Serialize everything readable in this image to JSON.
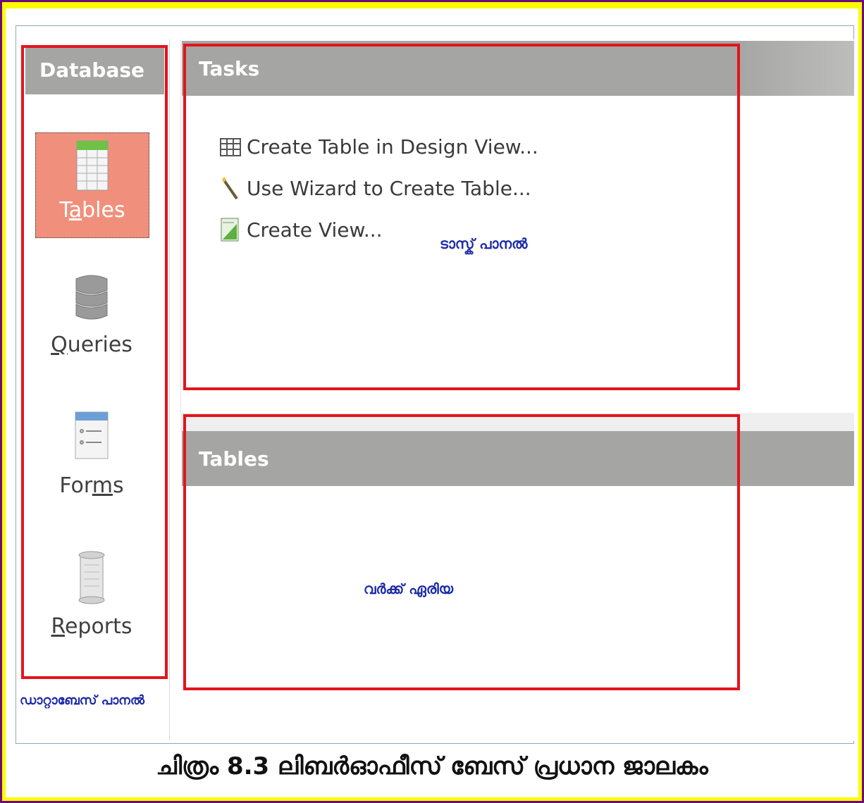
{
  "sidebar": {
    "header": "Database",
    "items": [
      {
        "label": "Tables",
        "underline_index": 1,
        "icon": "table-grid-icon",
        "selected": true
      },
      {
        "label": "Queries",
        "underline_index": 0,
        "icon": "database-cylinder-icon",
        "selected": false
      },
      {
        "label": "Forms",
        "underline_index": 3,
        "icon": "form-icon",
        "selected": false
      },
      {
        "label": "Reports",
        "underline_index": 0,
        "icon": "report-scroll-icon",
        "selected": false
      }
    ]
  },
  "tasks": {
    "header": "Tasks",
    "items": [
      {
        "label": "Create Table in Design View...",
        "icon": "table-design-icon"
      },
      {
        "label": "Use Wizard to Create Table...",
        "icon": "wand-icon"
      },
      {
        "label": "Create View...",
        "icon": "view-icon"
      }
    ]
  },
  "work": {
    "header": "Tables"
  },
  "annotations": {
    "task_panel": "ടാസ്ക് പാനൽ",
    "work_area": "വർക്ക് ഏരിയ",
    "database_panel": "ഡാറ്റാബേസ് പാനൽ"
  },
  "caption": "ചിത്രം 8.3 ലിബർഓഫീസ് ബേസ് പ്രധാന ജാലകം",
  "colors": {
    "frame_yellow": "#fcfc00",
    "frame_purple": "#6a0d7a",
    "header_gray": "#a5a5a3",
    "selected_bg": "#f0907c",
    "annotation_red": "#e2141e",
    "annotation_blue": "#1a2aa8"
  }
}
